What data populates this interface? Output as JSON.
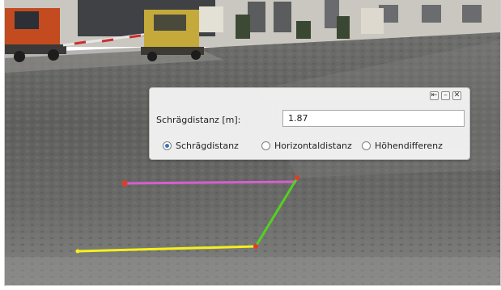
{
  "dialog": {
    "controls": {
      "pin_symbol": "⇤",
      "minimize_symbol": "–",
      "close_symbol": "✕"
    },
    "field_label": "Schrägdistanz [m]:",
    "field_value": "1.87",
    "modes": [
      {
        "label": "Schrägdistanz",
        "selected": true
      },
      {
        "label": "Horizontaldistanz",
        "selected": false
      },
      {
        "label": "Höhendifferenz",
        "selected": false
      }
    ]
  },
  "measurement": {
    "colors": {
      "horizontal": "#f4f01c",
      "slope": "#52d21f",
      "reference": "#d55fd0",
      "vertex": "#e43a2a"
    }
  }
}
